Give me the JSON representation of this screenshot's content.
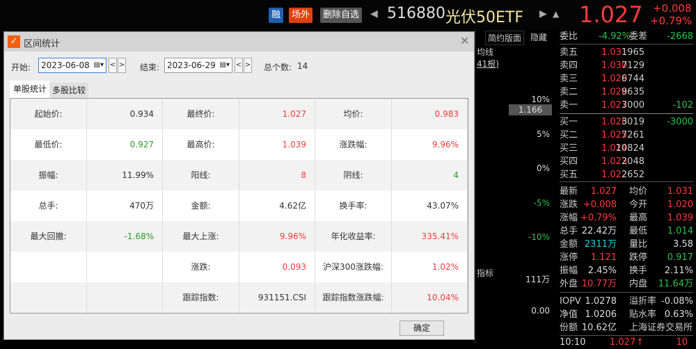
{
  "header": {
    "badge_rong": "融",
    "badge_changwai": "场外",
    "remove_watch": "删除自选",
    "code": "516880",
    "name": "光伏50ETF",
    "price": "1.027",
    "change": "+0.008",
    "change_pct": "+0.79%"
  },
  "chart": {
    "simple_view": "简约版面",
    "hide": "隐藏",
    "ma_label": "均线",
    "bars_label": "41根)",
    "price_tag": "1.166",
    "pct_ticks": [
      "10%",
      "5%",
      "0%",
      "-5%",
      "-10%"
    ],
    "indicator_label": "指标",
    "vol_ticks": [
      "111万",
      "0.00"
    ]
  },
  "orderbook": {
    "weibi_label": "委比",
    "weibi": "-4.92%",
    "weicha_label": "委差",
    "weicha": "-2668",
    "asks": [
      {
        "label": "卖五",
        "price": "1.031",
        "vol": "1965",
        "chg": ""
      },
      {
        "label": "卖四",
        "price": "1.030",
        "vol": "7129",
        "chg": ""
      },
      {
        "label": "卖三",
        "price": "1.029",
        "vol": "6744",
        "chg": ""
      },
      {
        "label": "卖二",
        "price": "1.028",
        "vol": "9635",
        "chg": ""
      },
      {
        "label": "卖一",
        "price": "1.027",
        "vol": "3000",
        "chg": "-102"
      }
    ],
    "bids": [
      {
        "label": "买一",
        "price": "1.026",
        "vol": "3019",
        "chg": "-3000"
      },
      {
        "label": "买二",
        "price": "1.025",
        "vol": "7261",
        "chg": ""
      },
      {
        "label": "买三",
        "price": "1.024",
        "vol": "10824",
        "chg": ""
      },
      {
        "label": "买四",
        "price": "1.023",
        "vol": "2048",
        "chg": ""
      },
      {
        "label": "买五",
        "price": "1.022",
        "vol": "2652",
        "chg": ""
      }
    ],
    "stats": [
      {
        "l1": "最新",
        "v1": "1.027",
        "c1": "red",
        "l2": "均价",
        "v2": "1.031",
        "c2": "red"
      },
      {
        "l1": "涨跌",
        "v1": "+0.008",
        "c1": "red",
        "l2": "今开",
        "v2": "1.020",
        "c2": "red"
      },
      {
        "l1": "涨幅",
        "v1": "+0.79%",
        "c1": "red",
        "l2": "最高",
        "v2": "1.039",
        "c2": "red"
      },
      {
        "l1": "总手",
        "v1": "22.42万",
        "c1": "white",
        "l2": "最低",
        "v2": "1.014",
        "c2": "green"
      },
      {
        "l1": "金额",
        "v1": "2311万",
        "c1": "cyan",
        "l2": "量比",
        "v2": "3.58",
        "c2": "white"
      },
      {
        "l1": "涨停",
        "v1": "1.121",
        "c1": "red",
        "l2": "跌停",
        "v2": "0.917",
        "c2": "green"
      },
      {
        "l1": "振幅",
        "v1": "2.45%",
        "c1": "white",
        "l2": "换手",
        "v2": "2.11%",
        "c2": "white"
      },
      {
        "l1": "外盘",
        "v1": "10.77万",
        "c1": "red",
        "l2": "内盘",
        "v2": "11.64万",
        "c2": "green"
      }
    ],
    "etf": [
      {
        "l1": "IOPV",
        "v1": "1.0278",
        "l2": "溢折率",
        "v2": "-0.08%"
      },
      {
        "l1": "净值",
        "v1": "1.0206",
        "l2": "贴水率",
        "v2": "0.63%"
      },
      {
        "l1": "份额",
        "v1": "10.62亿",
        "l2": "上海证券交易所",
        "v2": ""
      }
    ],
    "tick": {
      "time": "10:10",
      "price": "1.027",
      "arrow": "↑",
      "vol": "10"
    }
  },
  "dialog": {
    "title": "区间统计",
    "start_label": "开始:",
    "start_value": "2023-06-08",
    "end_label": "结束:",
    "end_value": "2023-06-29",
    "count_label": "总个数:",
    "count": "14",
    "tabs": [
      "单股统计",
      "多股比较"
    ],
    "ok": "确定",
    "rows": [
      [
        {
          "l": "起始价:",
          "v": "0.934",
          "c": "#333"
        },
        {
          "l": "最终价:",
          "v": "1.027",
          "c": "#f03c3c"
        },
        {
          "l": "均价:",
          "v": "0.983",
          "c": "#f03c3c"
        }
      ],
      [
        {
          "l": "最低价:",
          "v": "0.927",
          "c": "#2a9a2a"
        },
        {
          "l": "最高价:",
          "v": "1.039",
          "c": "#f03c3c"
        },
        {
          "l": "涨跌幅:",
          "v": "9.96%",
          "c": "#f03c3c"
        }
      ],
      [
        {
          "l": "振幅:",
          "v": "11.99%",
          "c": "#333"
        },
        {
          "l": "阳线:",
          "v": "8",
          "c": "#f03c3c"
        },
        {
          "l": "阴线:",
          "v": "4",
          "c": "#2a9a2a"
        }
      ],
      [
        {
          "l": "总手:",
          "v": "470万",
          "c": "#333"
        },
        {
          "l": "金额:",
          "v": "4.62亿",
          "c": "#333"
        },
        {
          "l": "换手率:",
          "v": "43.07%",
          "c": "#333"
        }
      ],
      [
        {
          "l": "最大回撤:",
          "v": "-1.68%",
          "c": "#2a9a2a"
        },
        {
          "l": "最大上涨:",
          "v": "9.96%",
          "c": "#f03c3c"
        },
        {
          "l": "年化收益率:",
          "v": "335.41%",
          "c": "#f03c3c"
        }
      ],
      [
        {
          "l": "",
          "v": "",
          "c": "#333"
        },
        {
          "l": "涨跌:",
          "v": "0.093",
          "c": "#f03c3c"
        },
        {
          "l": "沪深300涨跌幅:",
          "v": "1.02%",
          "c": "#f03c3c"
        }
      ],
      [
        {
          "l": "",
          "v": "",
          "c": "#333"
        },
        {
          "l": "跟踪指数:",
          "v": "931151.CSI",
          "c": "#333"
        },
        {
          "l": "跟踪指数涨跌幅:",
          "v": "10.04%",
          "c": "#f03c3c"
        }
      ]
    ]
  }
}
